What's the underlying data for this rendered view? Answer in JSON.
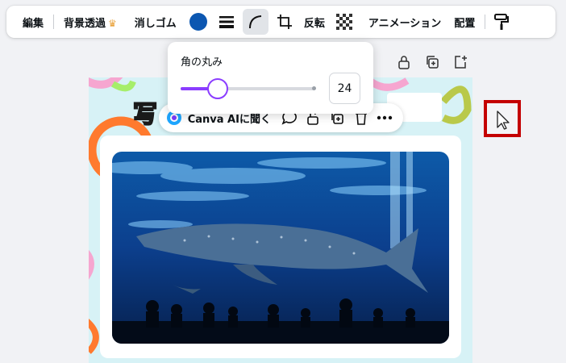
{
  "toolbar": {
    "edit": "編集",
    "bg_remove": "背景透過",
    "eraser": "消しゴム",
    "flip": "反転",
    "animate": "アニメーション",
    "position": "配置",
    "color": "#0c57b1",
    "icons": [
      "crown-icon",
      "line-weight-icon",
      "corner-rounding-icon",
      "crop-icon",
      "transparency-icon",
      "paint-roller-icon"
    ]
  },
  "popover": {
    "title": "角の丸み",
    "value": "24",
    "slider_fraction": 0.28
  },
  "context_bar": {
    "ai_label": "Canva AIに聞く",
    "icons": [
      "canva-ai-icon",
      "comment-icon",
      "lock-icon",
      "duplicate-icon",
      "delete-icon",
      "more-icon"
    ]
  },
  "page": {
    "title_glyph": "写"
  },
  "page_actions": [
    "lock-icon",
    "duplicate-page-icon",
    "add-page-icon"
  ]
}
